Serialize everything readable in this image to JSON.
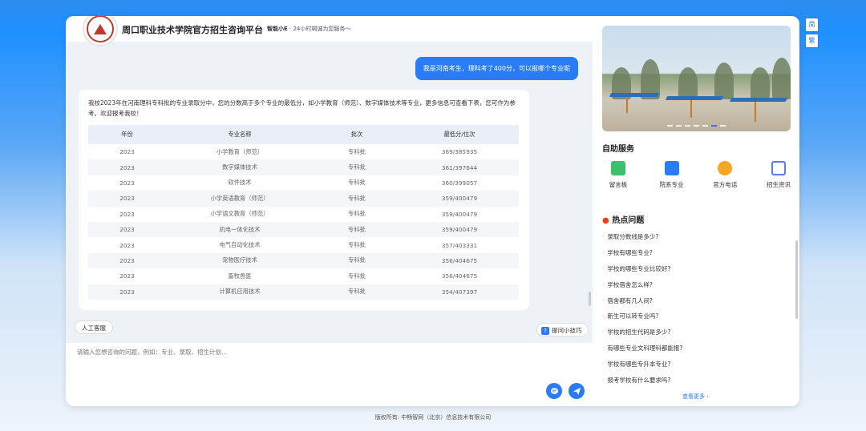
{
  "header": {
    "title": "周口职业技术学院官方招生咨询平台",
    "assistant_name": "智能小E",
    "tagline": "· 24小时竭诚为您服务～"
  },
  "conversation": {
    "user_message": "我是河南考生，理科考了400分，可以报哪个专业呢",
    "answer_intro": "我校2023年在河南理科专科批的专业录取分中，您的分数高于多个专业的最低分，如小学教育（师范）、数字媒体技术等专业，更多信息可查看下表，您可作为参考。欢迎报考我校！",
    "table": {
      "headers": [
        "年份",
        "专业名称",
        "批次",
        "最低分/位次"
      ],
      "rows": [
        [
          "2023",
          "小学教育（师范）",
          "专科批",
          "369/385935"
        ],
        [
          "2023",
          "数字媒体技术",
          "专科批",
          "361/397644"
        ],
        [
          "2023",
          "软件技术",
          "专科批",
          "360/399057"
        ],
        [
          "2023",
          "小学英语教育（师范）",
          "专科批",
          "359/400479"
        ],
        [
          "2023",
          "小学语文教育（师范）",
          "专科批",
          "359/400479"
        ],
        [
          "2023",
          "机电一体化技术",
          "专科批",
          "359/400479"
        ],
        [
          "2023",
          "电气自动化技术",
          "专科批",
          "357/403331"
        ],
        [
          "2023",
          "宠物医疗技术",
          "专科批",
          "356/404675"
        ],
        [
          "2023",
          "畜牧兽医",
          "专科批",
          "356/404675"
        ],
        [
          "2023",
          "计算机应用技术",
          "专科批",
          "354/407397"
        ]
      ]
    }
  },
  "actions": {
    "human_service": "人工客服",
    "tips": "提问小技巧",
    "tips_icon": "?"
  },
  "input": {
    "placeholder": "请输入您想咨询的问题，例如：专业、录取、招生计划..."
  },
  "sidebar": {
    "self_service_title": "自助服务",
    "services": [
      {
        "label": "留言板",
        "icon": "message-board-icon",
        "color": "#3cc06b"
      },
      {
        "label": "院系专业",
        "icon": "book-icon",
        "color": "#2a7cf6"
      },
      {
        "label": "官方电话",
        "icon": "phone-icon",
        "color": "#f5a623"
      },
      {
        "label": "招生资讯",
        "icon": "news-icon",
        "color": "#5b7cf6"
      }
    ],
    "hot_title": "热点问题",
    "hot_questions": [
      "录取分数线是多少?",
      "学校有哪些专业?",
      "学校的哪些专业比较好?",
      "学校宿舍怎么样?",
      "宿舍都有几人间?",
      "新生可以转专业吗?",
      "学校的招生代码是多少?",
      "有哪些专业文科理科都能报?",
      "学校有哪些专升本专业?",
      "报考学校有什么要求吗?"
    ],
    "more": "查看更多 ›"
  },
  "lang_switch": {
    "simplified": "简",
    "traditional": "繁"
  },
  "footer": "版权所有: 中畅智网（北京）信息技术有限公司",
  "colors": {
    "accent": "#2a7cf6",
    "hot": "#e8421f"
  }
}
